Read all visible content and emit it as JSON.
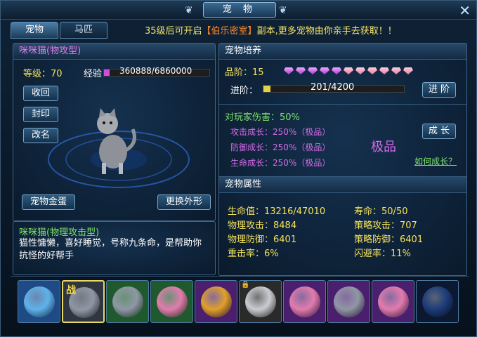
{
  "window": {
    "title": "宠 物",
    "close": "✕"
  },
  "tabs": [
    {
      "label": "宠物",
      "active": true
    },
    {
      "label": "马匹",
      "active": false
    }
  ],
  "notice": {
    "prefix": "35级后可开启",
    "highlight": "【伯乐密室】",
    "suffix": "副本,更多宠物由你亲手去获取！！"
  },
  "pet": {
    "name": "咪咪猫(物攻型)",
    "level_label": "等级：",
    "level": "70",
    "exp_label": "经验",
    "exp_value": "360888/6860000",
    "exp_fraction": 0.053,
    "actions": {
      "recall": "收回",
      "seal": "封印",
      "rename": "改名"
    },
    "egg_button": "宠物金蛋",
    "change_button": "更换外形",
    "desc_title": "咪咪猫(物理攻击型)",
    "desc_text": "猫性慵懒，喜好睡觉，号称九条命，是帮助你抗怪的好帮手"
  },
  "cultivate": {
    "header": "宠物培养",
    "grade_label": "品阶：",
    "grade": "15",
    "diamond_count": 11,
    "advance_label": "进阶：",
    "advance_value": "201/4200",
    "advance_fraction": 0.048,
    "advance_button": "进 阶",
    "damage_label": "对玩家伤害：",
    "damage_value": "50%",
    "growth": [
      {
        "label": "攻击成长：",
        "value": "250%（极品）"
      },
      {
        "label": "防御成长：",
        "value": "250%（极品）"
      },
      {
        "label": "生命成长：",
        "value": "250%（极品）"
      }
    ],
    "quality": "极品",
    "grow_button": "成 长",
    "how_link": "如何成长？"
  },
  "attributes": {
    "header": "宠物属性",
    "items": [
      {
        "label": "生命值：",
        "value": "13216/47010"
      },
      {
        "label": "寿命：",
        "value": "50/50"
      },
      {
        "label": "物理攻击：",
        "value": "8484"
      },
      {
        "label": "策略攻击：",
        "value": "707"
      },
      {
        "label": "物理防御：",
        "value": "6401"
      },
      {
        "label": "策略防御：",
        "value": "6401"
      },
      {
        "label": "重击率：",
        "value": "6%"
      },
      {
        "label": "闪避率：",
        "value": "11%"
      }
    ]
  },
  "pet_slots": {
    "battle_badge": "战",
    "slots": [
      {
        "icon": "blue-beast-icon",
        "color": "#5fb2ea",
        "bg": "#1e4a85"
      },
      {
        "icon": "gray-cat-icon",
        "color": "#8f97a5",
        "bg": "#2f3640",
        "active": true
      },
      {
        "icon": "gray-cat-icon",
        "color": "#8f97a5",
        "bg": "#1e5a2e"
      },
      {
        "icon": "pink-leopard-icon",
        "color": "#e27cad",
        "bg": "#1e5a2e"
      },
      {
        "icon": "golden-dragon-icon",
        "color": "#e0a02a",
        "bg": "#4a1f6e"
      },
      {
        "icon": "white-eagle-icon",
        "color": "#c9ccd1",
        "bg": "#2a2a2a",
        "locked": true
      },
      {
        "icon": "pink-leopard-icon",
        "color": "#e27cad",
        "bg": "#4a1f6e"
      },
      {
        "icon": "gray-cat-icon",
        "color": "#8f97a5",
        "bg": "#4a1f6e"
      },
      {
        "icon": "pink-leopard-icon",
        "color": "#e27cad",
        "bg": "#4a1f6e"
      },
      {
        "icon": "empty-slot-icon",
        "color": "#1c3c7a",
        "bg": "#0c1730"
      }
    ]
  }
}
